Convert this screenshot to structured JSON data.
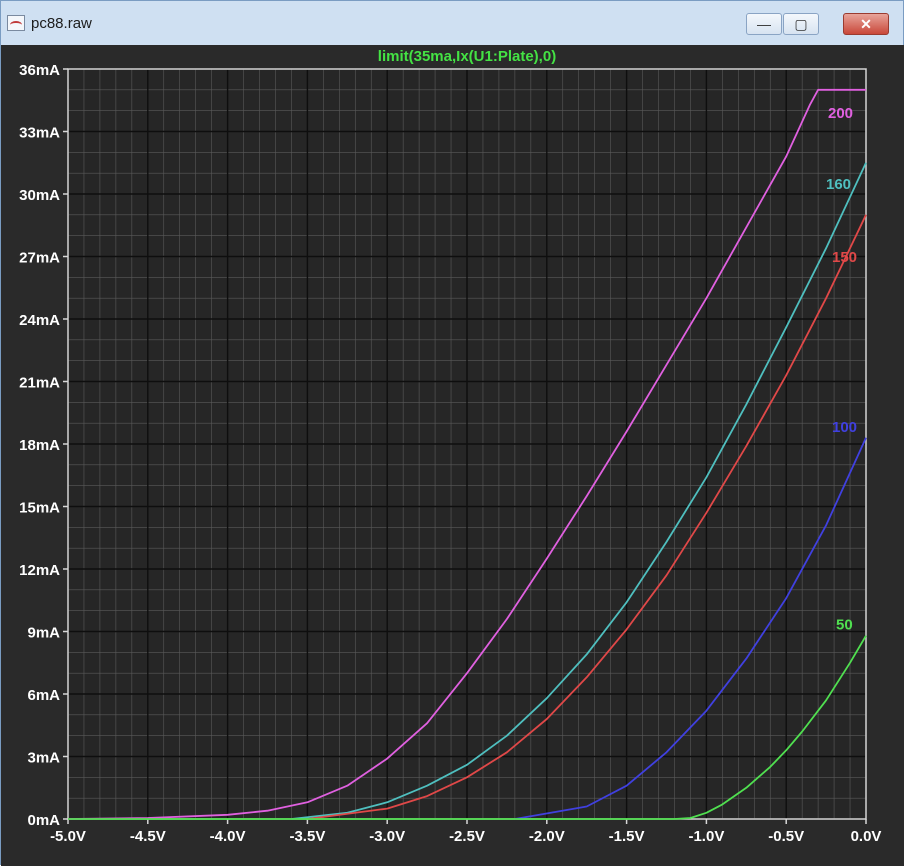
{
  "window": {
    "title": "pc88.raw",
    "minimize_icon": "minimize-icon",
    "maximize_icon": "maximize-icon",
    "close_icon": "close-icon",
    "minimize_glyph": "—",
    "maximize_glyph": "▢",
    "close_glyph": "✕"
  },
  "chart_data": {
    "type": "line",
    "title": "limit(35ma,Ix(U1:Plate),0)",
    "xlabel": "",
    "ylabel": "",
    "xlim": [
      -5.0,
      0.0
    ],
    "ylim": [
      0,
      36
    ],
    "grid": true,
    "x_ticks": [
      -5.0,
      -4.5,
      -4.0,
      -3.5,
      -3.0,
      -2.5,
      -2.0,
      -1.5,
      -1.0,
      -0.5,
      0.0
    ],
    "x_tick_labels": [
      "-5.0V",
      "-4.5V",
      "-4.0V",
      "-3.5V",
      "-3.0V",
      "-2.5V",
      "-2.0V",
      "-1.5V",
      "-1.0V",
      "-0.5V",
      "0.0V"
    ],
    "y_ticks": [
      0,
      3,
      6,
      9,
      12,
      15,
      18,
      21,
      24,
      27,
      30,
      33,
      36
    ],
    "y_tick_labels": [
      "0mA",
      "3mA",
      "6mA",
      "9mA",
      "12mA",
      "15mA",
      "18mA",
      "21mA",
      "24mA",
      "27mA",
      "30mA",
      "33mA",
      "36mA"
    ],
    "series": [
      {
        "name": "200",
        "color": "#e060e0",
        "x": [
          -5.0,
          -4.5,
          -4.0,
          -3.75,
          -3.5,
          -3.25,
          -3.0,
          -2.75,
          -2.5,
          -2.25,
          -2.0,
          -1.75,
          -1.5,
          -1.25,
          -1.0,
          -0.75,
          -0.5,
          -0.35,
          -0.3,
          0.0
        ],
        "y": [
          0.0,
          0.05,
          0.2,
          0.4,
          0.8,
          1.6,
          2.9,
          4.6,
          7.0,
          9.6,
          12.5,
          15.5,
          18.6,
          21.8,
          25.0,
          28.4,
          31.8,
          34.3,
          35.0,
          35.0
        ]
      },
      {
        "name": "160",
        "color": "#4fbfbf",
        "x": [
          -3.6,
          -3.25,
          -3.0,
          -2.75,
          -2.5,
          -2.25,
          -2.0,
          -1.75,
          -1.5,
          -1.25,
          -1.0,
          -0.75,
          -0.5,
          -0.25,
          0.0
        ],
        "y": [
          0.0,
          0.3,
          0.8,
          1.6,
          2.6,
          4.0,
          5.8,
          7.9,
          10.4,
          13.3,
          16.4,
          19.9,
          23.6,
          27.4,
          31.5
        ]
      },
      {
        "name": "150",
        "color": "#e04848",
        "x": [
          -3.5,
          -3.0,
          -2.75,
          -2.5,
          -2.25,
          -2.0,
          -1.75,
          -1.5,
          -1.25,
          -1.0,
          -0.75,
          -0.5,
          -0.25,
          0.0
        ],
        "y": [
          0.0,
          0.5,
          1.1,
          2.0,
          3.2,
          4.8,
          6.8,
          9.1,
          11.7,
          14.7,
          17.9,
          21.3,
          25.0,
          29.0
        ]
      },
      {
        "name": "100",
        "color": "#4040e0",
        "x": [
          -2.2,
          -1.75,
          -1.5,
          -1.25,
          -1.0,
          -0.75,
          -0.5,
          -0.25,
          0.0
        ],
        "y": [
          0.0,
          0.6,
          1.6,
          3.2,
          5.2,
          7.7,
          10.6,
          14.1,
          18.3
        ]
      },
      {
        "name": "50",
        "color": "#50e050",
        "x": [
          -5.0,
          -1.2,
          -1.1,
          -1.0,
          -0.9,
          -0.75,
          -0.6,
          -0.5,
          -0.4,
          -0.25,
          -0.1,
          0.0
        ],
        "y": [
          0.0,
          0.0,
          0.05,
          0.3,
          0.7,
          1.5,
          2.5,
          3.3,
          4.2,
          5.7,
          7.5,
          8.8
        ]
      }
    ]
  }
}
